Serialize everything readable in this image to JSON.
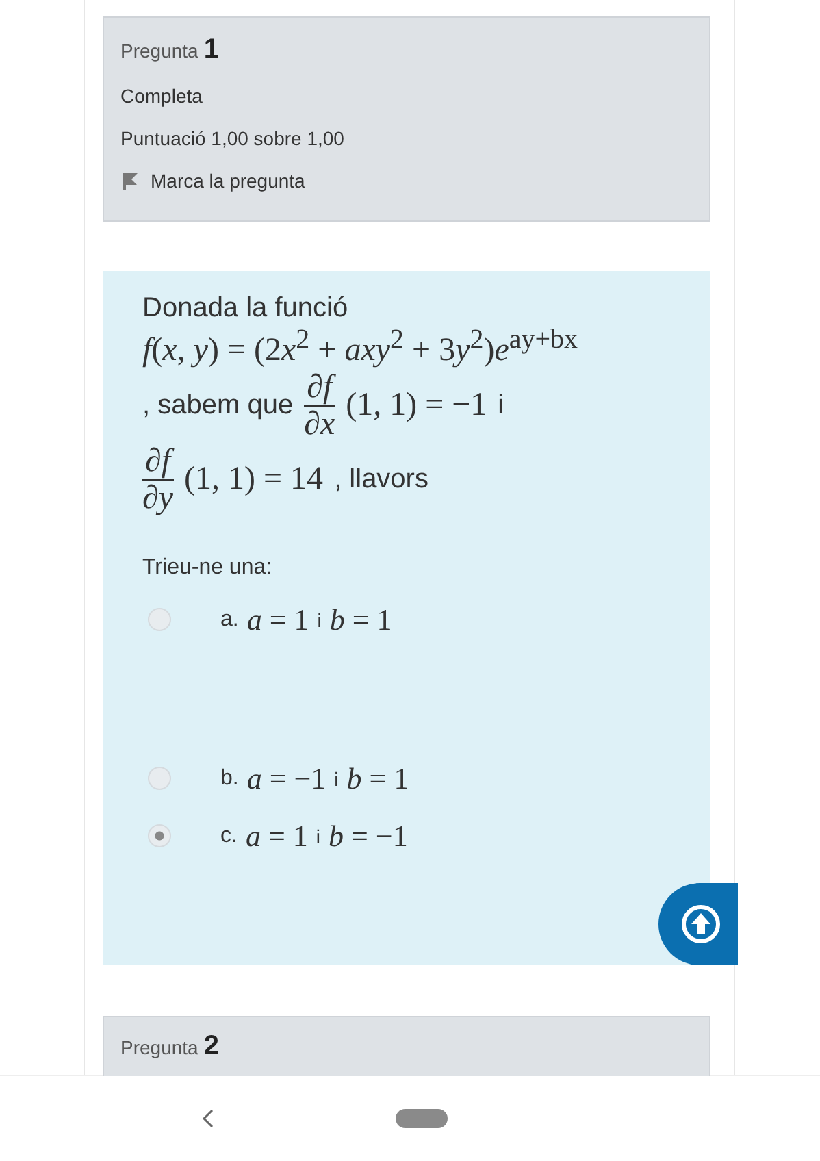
{
  "question_1": {
    "label": "Pregunta",
    "number": "1",
    "state": "Completa",
    "grade": "Puntuació 1,00 sobre 1,00",
    "flag": {
      "label": "Marca la pregunta",
      "flagged": false
    }
  },
  "stem": [
    {
      "kind": "text",
      "text": "Donada la funció"
    },
    {
      "kind": "formula",
      "parts": [
        "*f*(*x*, *y*) = (2",
        "*x*$^{2}$ + *axy*$^{2}$ + 3",
        "*y*$^{2}$)*e*$^{ay+bx}$"
      ]
    },
    {
      "kind": "row",
      "parts": [
        {
          "kind": "text",
          "text": ", sabem que"
        },
        {
          "kind": "frac",
          "num": "∂f",
          "den": "∂x"
        },
        {
          "kind": "math",
          "text": "(1, 1) = −1"
        },
        {
          "kind": "text",
          "text": "i"
        }
      ]
    },
    {
      "kind": "row",
      "parts": [
        {
          "kind": "frac",
          "num": "∂f",
          "den": "∂y"
        },
        {
          "kind": "math",
          "text": "(1, 1) = 14"
        },
        {
          "kind": "text",
          "text": ", llavors"
        }
      ]
    }
  ],
  "prompt": "Trieu-ne una:",
  "options": [
    {
      "letter": "a.",
      "parts": [
        {
          "kind": "math",
          "text": "*a* = 1"
        },
        {
          "kind": "text",
          "text": "i"
        },
        {
          "kind": "math",
          "text": "*b* = 1"
        }
      ],
      "selected": false
    },
    {
      "letter": "b.",
      "parts": [
        {
          "kind": "math",
          "text": "*a* = −1"
        },
        {
          "kind": "text",
          "text": "i"
        },
        {
          "kind": "math",
          "text": "*b* = 1"
        }
      ],
      "selected": false
    },
    {
      "letter": "c.",
      "parts": [
        {
          "kind": "math",
          "text": "*a* = 1"
        },
        {
          "kind": "text",
          "text": "i"
        },
        {
          "kind": "math",
          "text": "*b* = −1"
        }
      ],
      "selected": true
    }
  ],
  "question_2": {
    "label": "Pregunta",
    "number": "2"
  }
}
